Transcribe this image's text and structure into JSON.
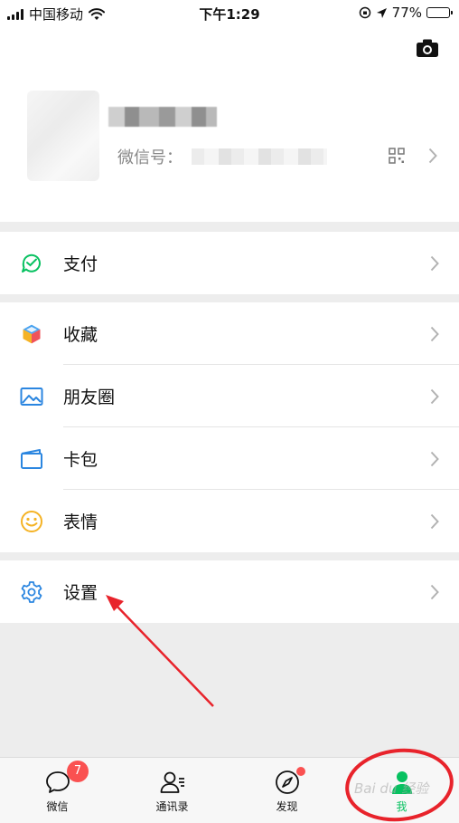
{
  "status_bar": {
    "carrier": "中国移动",
    "time": "下午1:29",
    "battery": "77%"
  },
  "profile": {
    "wechat_id_label": "微信号："
  },
  "menu": {
    "pay": "支付",
    "favorites": "收藏",
    "moments": "朋友圈",
    "cards": "卡包",
    "stickers": "表情",
    "settings": "设置"
  },
  "tabbar": {
    "chats": "微信",
    "chats_badge": "7",
    "contacts": "通讯录",
    "discover": "发现",
    "me": "我"
  },
  "watermark": "Bai du 经验",
  "colors": {
    "accent": "#07c160",
    "badge": "#fa5151",
    "annotation": "#e8232b"
  }
}
